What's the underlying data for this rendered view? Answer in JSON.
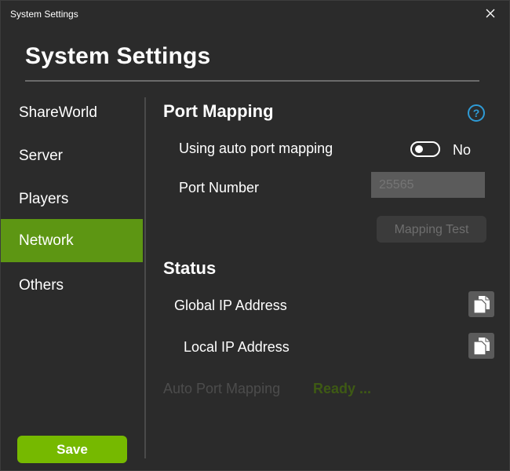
{
  "window": {
    "title": "System Settings"
  },
  "header": {
    "title": "System Settings"
  },
  "sidebar": {
    "items": [
      {
        "label": "ShareWorld"
      },
      {
        "label": "Server"
      },
      {
        "label": "Players"
      },
      {
        "label": "Network"
      },
      {
        "label": "Others"
      }
    ],
    "active_index": 3,
    "save_label": "Save"
  },
  "port_mapping": {
    "title": "Port Mapping",
    "auto_label": "Using auto port mapping",
    "auto_enabled": false,
    "auto_state_text": "No",
    "port_label": "Port Number",
    "port_placeholder": "25565",
    "test_button_label": "Mapping Test"
  },
  "status": {
    "title": "Status",
    "global_ip_label": "Global IP Address",
    "local_ip_label": "Local IP Address",
    "auto_mapping_label": "Auto Port Mapping",
    "auto_mapping_value": "Ready ..."
  },
  "icons": {
    "close": "close-icon",
    "help": "help-icon",
    "copy": "copy-icon"
  },
  "colors": {
    "accent": "#76b900",
    "active_nav": "#5d9613",
    "help": "#2e9bd6"
  }
}
